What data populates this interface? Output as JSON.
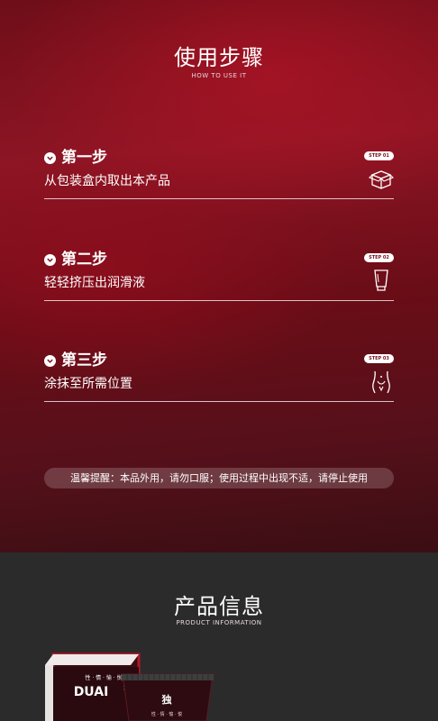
{
  "usage": {
    "title": "使用步骤",
    "subtitle": "HOW TO USE IT",
    "steps": [
      {
        "title": "第一步",
        "desc": "从包装盒内取出本产品",
        "badge": "STEP 01",
        "icon": "box-icon"
      },
      {
        "title": "第二步",
        "desc": "轻轻挤压出润滑液",
        "badge": "STEP 02",
        "icon": "tube-icon"
      },
      {
        "title": "第三步",
        "desc": "涂抹至所需位置",
        "badge": "STEP 03",
        "icon": "body-icon"
      }
    ],
    "notice": "温馨提醒：本品外用，请勿口服；使用过程中出现不适，请停止使用"
  },
  "product_info": {
    "title": "产品信息",
    "subtitle": "PRODUCT INFORMATION",
    "brand": "DUAI"
  },
  "colors": {
    "red_bg": "#8d1524",
    "dark_bg": "#2b2b2b",
    "text": "#ffffff"
  }
}
